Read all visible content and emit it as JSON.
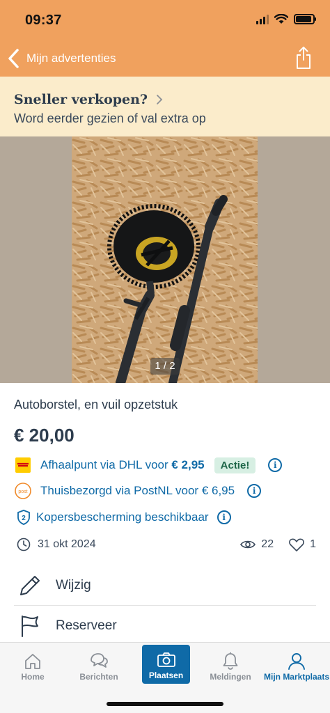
{
  "status_bar": {
    "time": "09:37"
  },
  "nav": {
    "back_label": "Mijn advertenties"
  },
  "promo": {
    "title": "Sneller verkopen?",
    "subtitle": "Word eerder gezien of val extra op"
  },
  "gallery": {
    "counter": "1 / 2"
  },
  "listing": {
    "title": "Autoborstel, en vuil opzetstuk",
    "price": "€ 20,00"
  },
  "shipping": [
    {
      "text": "Afhaalpunt via DHL voor",
      "price": "€ 2,95",
      "badge": "Actie!",
      "icon": "dhl-icon"
    },
    {
      "text": "Thuisbezorgd via PostNL voor",
      "price": "€ 6,95",
      "icon": "postnl-icon"
    }
  ],
  "protection": {
    "text": "Kopersbescherming beschikbaar"
  },
  "meta": {
    "date": "31 okt 2024",
    "views": "22",
    "favorites": "1"
  },
  "actions": [
    {
      "label": "Wijzig",
      "icon": "pencil-icon"
    },
    {
      "label": "Reserveer",
      "icon": "flag-icon"
    }
  ],
  "tabs": [
    {
      "label": "Home",
      "icon": "home-icon"
    },
    {
      "label": "Berichten",
      "icon": "chat-icon"
    },
    {
      "label": "Plaatsen",
      "icon": "camera-icon"
    },
    {
      "label": "Meldingen",
      "icon": "bell-icon"
    },
    {
      "label": "Mijn Marktplaats",
      "icon": "user-icon"
    }
  ],
  "colors": {
    "header": "#f0a15e",
    "promo_bg": "#fbeccb",
    "link_blue": "#0f6aa7",
    "text_dark": "#2d3c4d",
    "actie_bg": "#d7efe3"
  }
}
